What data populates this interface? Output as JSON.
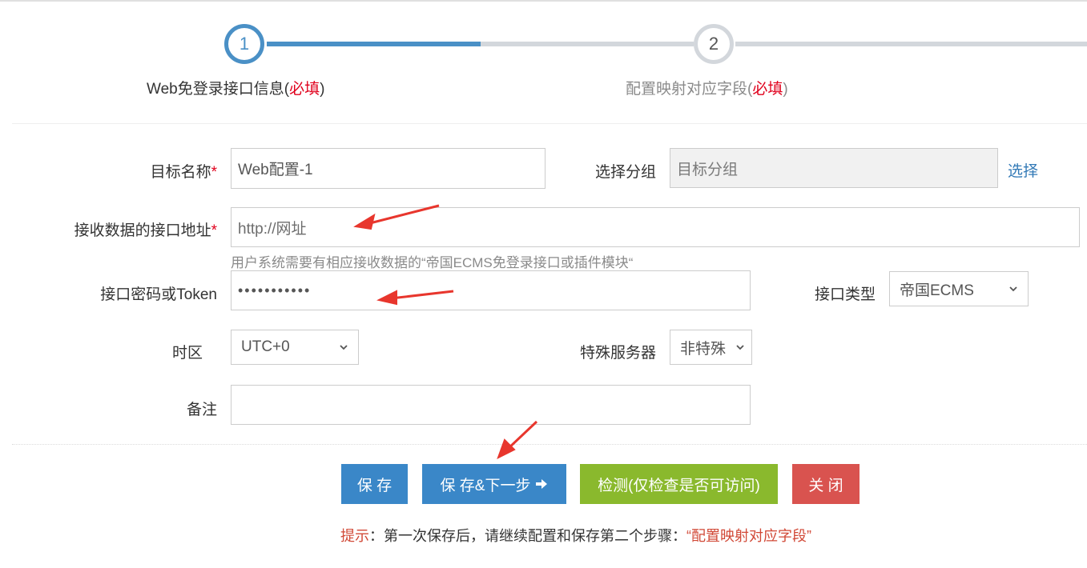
{
  "steps": [
    {
      "number": "1",
      "label": "Web免登录接口信息(",
      "required": "必填",
      "close": ")"
    },
    {
      "number": "2",
      "label": "配置映射对应字段(",
      "required": "必填",
      "close": ")"
    }
  ],
  "form": {
    "target_name": {
      "label": "目标名称",
      "star": "*",
      "value": "Web配置-1"
    },
    "group": {
      "label": "选择分组",
      "placeholder": "目标分组",
      "link": "选择"
    },
    "endpoint": {
      "label": "接收数据的接口地址",
      "star": "*",
      "placeholder": "http://网址",
      "help": "用户系统需要有相应接收数据的“帝国ECMS免登录接口或插件模块“"
    },
    "password": {
      "label": "接口密码或Token",
      "value": "•••••••••••"
    },
    "interface_type": {
      "label": "接口类型",
      "selected": "帝国ECMS"
    },
    "timezone": {
      "label": "时区",
      "selected": "UTC+0"
    },
    "special_server": {
      "label": "特殊服务器",
      "selected": "非特殊"
    },
    "remark": {
      "label": "备注",
      "value": ""
    }
  },
  "buttons": {
    "save": "保 存",
    "save_next": "保 存&下一步",
    "check": "检测(仅检查是否可访问)",
    "close": "关 闭"
  },
  "tip": {
    "label": "提示",
    "text": "：第一次保存后，请继续配置和保存第二个步骤：",
    "quote": "“配置映射对应字段”"
  },
  "colors": {
    "accent": "#4a90c6",
    "required": "#e0001c",
    "btn_blue": "#3a87c8",
    "btn_green": "#8ab92d",
    "btn_red": "#d9534f",
    "annotation_arrow": "#e8362d"
  }
}
